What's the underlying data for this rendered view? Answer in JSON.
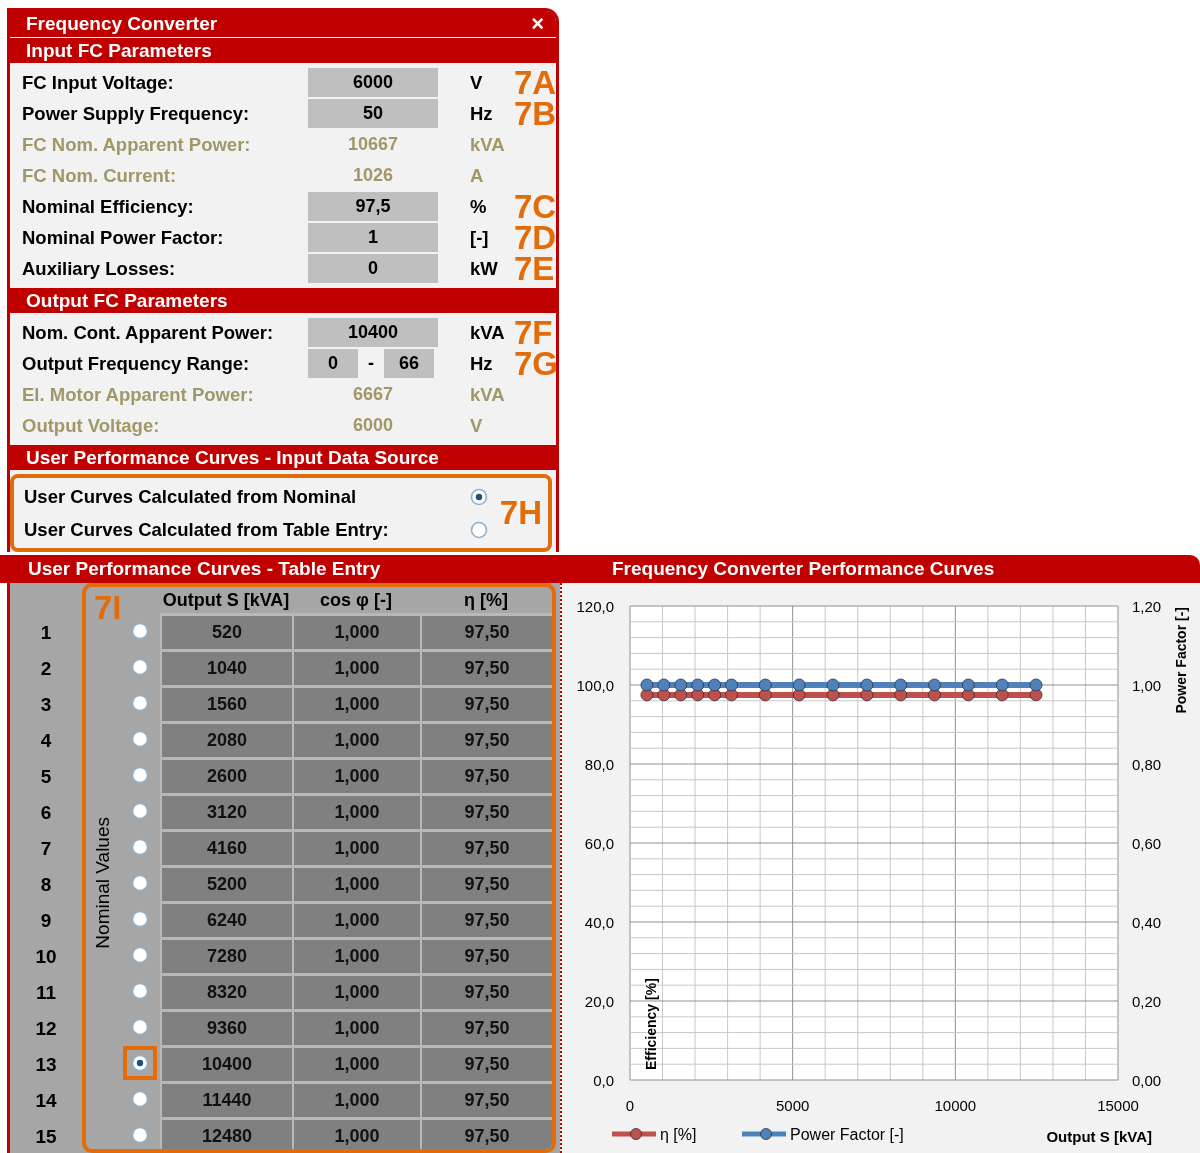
{
  "window": {
    "title": "Frequency Converter",
    "close": "×"
  },
  "input_section": {
    "title": "Input FC Parameters",
    "rows": [
      {
        "kind": "input",
        "label": "FC Input Voltage:",
        "value": "6000",
        "unit": "V",
        "marker": "7A"
      },
      {
        "kind": "input",
        "label": "Power Supply Frequency:",
        "value": "50",
        "unit": "Hz",
        "marker": "7B"
      },
      {
        "kind": "computed",
        "label": "FC Nom. Apparent Power:",
        "value": "10667",
        "unit": "kVA"
      },
      {
        "kind": "computed",
        "label": "FC Nom. Current:",
        "value": "1026",
        "unit": "A"
      },
      {
        "kind": "input",
        "label": "Nominal Efficiency:",
        "value": "97,5",
        "unit": "%",
        "marker": "7C"
      },
      {
        "kind": "input",
        "label": "Nominal Power Factor:",
        "value": "1",
        "unit": "[-]",
        "marker": "7D"
      },
      {
        "kind": "input",
        "label": "Auxiliary Losses:",
        "value": "0",
        "unit": "kW",
        "marker": "7E"
      }
    ]
  },
  "output_section": {
    "title": "Output FC Parameters",
    "rows": [
      {
        "kind": "input",
        "label": "Nom. Cont. Apparent Power:",
        "value": "10400",
        "unit": "kVA",
        "marker": "7F"
      },
      {
        "kind": "range",
        "label": "Output Frequency Range:",
        "value_from": "0",
        "separator": "-",
        "value_to": "66",
        "unit": "Hz",
        "marker": "7G"
      },
      {
        "kind": "computed",
        "label": "El. Motor Apparent Power:",
        "value": "6667",
        "unit": "kVA"
      },
      {
        "kind": "computed",
        "label": "Output Voltage:",
        "value": "6000",
        "unit": "V"
      }
    ]
  },
  "source_section": {
    "title": "User Performance Curves - Input Data Source",
    "marker": "7H",
    "options": [
      {
        "label": "User Curves Calculated from Nominal",
        "selected": true
      },
      {
        "label": "User Curves Calculated from Table Entry:",
        "selected": false
      }
    ]
  },
  "table_section": {
    "title": "User Performance Curves - Table Entry",
    "marker": "7I",
    "side_label": "Nominal Values",
    "columns": [
      "Output S [kVA]",
      "cos φ [-]",
      "η [%]"
    ],
    "rows": [
      {
        "index": "1",
        "selected": false,
        "cells": [
          "520",
          "1,000",
          "97,50"
        ]
      },
      {
        "index": "2",
        "selected": false,
        "cells": [
          "1040",
          "1,000",
          "97,50"
        ]
      },
      {
        "index": "3",
        "selected": false,
        "cells": [
          "1560",
          "1,000",
          "97,50"
        ]
      },
      {
        "index": "4",
        "selected": false,
        "cells": [
          "2080",
          "1,000",
          "97,50"
        ]
      },
      {
        "index": "5",
        "selected": false,
        "cells": [
          "2600",
          "1,000",
          "97,50"
        ]
      },
      {
        "index": "6",
        "selected": false,
        "cells": [
          "3120",
          "1,000",
          "97,50"
        ]
      },
      {
        "index": "7",
        "selected": false,
        "cells": [
          "4160",
          "1,000",
          "97,50"
        ]
      },
      {
        "index": "8",
        "selected": false,
        "cells": [
          "5200",
          "1,000",
          "97,50"
        ]
      },
      {
        "index": "9",
        "selected": false,
        "cells": [
          "6240",
          "1,000",
          "97,50"
        ]
      },
      {
        "index": "10",
        "selected": false,
        "cells": [
          "7280",
          "1,000",
          "97,50"
        ]
      },
      {
        "index": "11",
        "selected": false,
        "cells": [
          "8320",
          "1,000",
          "97,50"
        ]
      },
      {
        "index": "12",
        "selected": false,
        "cells": [
          "9360",
          "1,000",
          "97,50"
        ]
      },
      {
        "index": "13",
        "selected": true,
        "cells": [
          "10400",
          "1,000",
          "97,50"
        ]
      },
      {
        "index": "14",
        "selected": false,
        "cells": [
          "11440",
          "1,000",
          "97,50"
        ]
      },
      {
        "index": "15",
        "selected": false,
        "cells": [
          "12480",
          "1,000",
          "97,50"
        ]
      }
    ]
  },
  "chart_section": {
    "title": "Frequency Converter Performance Curves",
    "chart_data": {
      "type": "line",
      "grid": true,
      "legend": true,
      "xlabel": "Output  S [kVA]",
      "ylabel": "Efficiency [%]",
      "x": [
        520,
        1040,
        1560,
        2080,
        2600,
        3120,
        4160,
        5200,
        6240,
        7280,
        8320,
        9360,
        10400,
        11440,
        12480
      ],
      "series": [
        {
          "name": "η [%]",
          "color": "#c0504d",
          "marker": "circle",
          "values": [
            97.5,
            97.5,
            97.5,
            97.5,
            97.5,
            97.5,
            97.5,
            97.5,
            97.5,
            97.5,
            97.5,
            97.5,
            97.5,
            97.5,
            97.5
          ]
        },
        {
          "name": "Power Factor [-]",
          "color": "#4f81bd",
          "marker": "circle",
          "axis": "y2",
          "values": [
            1,
            1,
            1,
            1,
            1,
            1,
            1,
            1,
            1,
            1,
            1,
            1,
            1,
            1,
            1
          ]
        }
      ],
      "xlim": [
        0,
        15000
      ],
      "ylim": [
        0,
        120
      ],
      "xticks": [
        0,
        5000,
        10000,
        15000
      ],
      "yticks": [
        {
          "value": 0,
          "label": "0,0"
        },
        {
          "value": 20,
          "label": "20,0"
        },
        {
          "value": 40,
          "label": "40,0"
        },
        {
          "value": 60,
          "label": "60,0"
        },
        {
          "value": 80,
          "label": "80,0"
        },
        {
          "value": 100,
          "label": "100,0"
        },
        {
          "value": 120,
          "label": "120,0"
        }
      ],
      "y2label": "Power Factor [-]",
      "y2lim": [
        0,
        1.2
      ],
      "y2ticks": [
        {
          "value": 0,
          "label": "0,00"
        },
        {
          "value": 0.2,
          "label": "0,20"
        },
        {
          "value": 0.4,
          "label": "0,40"
        },
        {
          "value": 0.6,
          "label": "0,60"
        },
        {
          "value": 0.8,
          "label": "0,80"
        },
        {
          "value": 1,
          "label": "1,00"
        },
        {
          "value": 1.2,
          "label": "1,20"
        }
      ]
    }
  }
}
